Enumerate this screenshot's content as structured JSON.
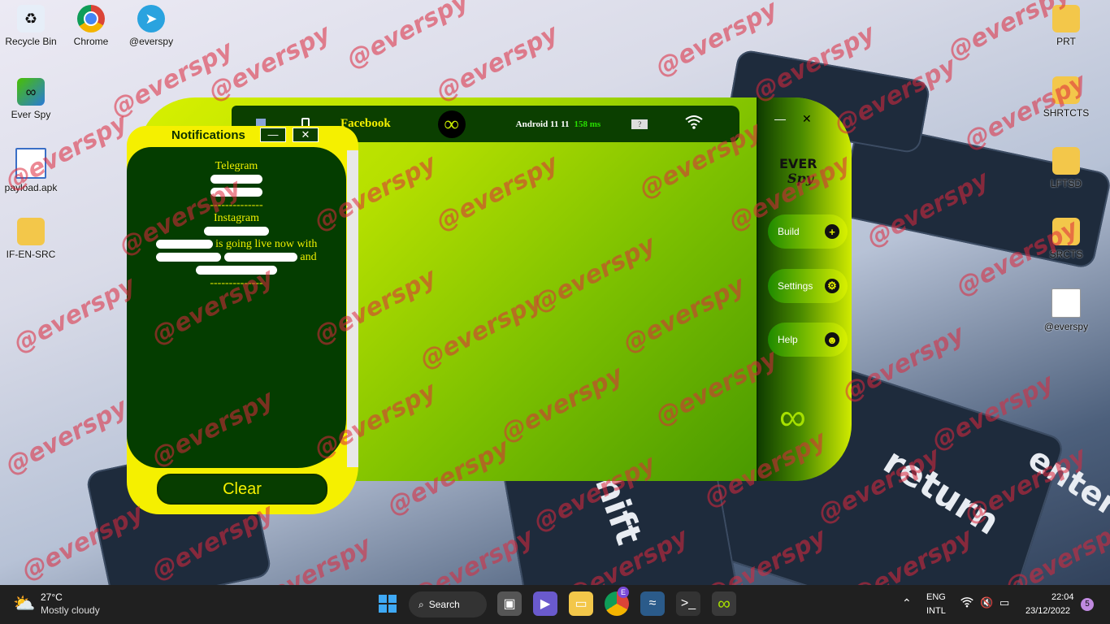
{
  "desktop": {
    "left_icons": [
      {
        "label": "Recycle Bin",
        "icon": "recycle-bin-icon"
      },
      {
        "label": "Chrome",
        "icon": "chrome-icon"
      },
      {
        "label": "@everspy",
        "icon": "telegram-icon"
      },
      {
        "label": "Ever Spy",
        "icon": "everspy-icon"
      },
      {
        "label": "payload.apk",
        "icon": "file-icon"
      },
      {
        "label": "IF-EN-SRC",
        "icon": "folder-icon"
      }
    ],
    "right_icons": [
      {
        "label": "PRT",
        "icon": "folder-icon"
      },
      {
        "label": "SHRTCTS",
        "icon": "folder-icon"
      },
      {
        "label": "LFTSD",
        "icon": "folder-icon"
      },
      {
        "label": "SRCTS",
        "icon": "folder-icon"
      },
      {
        "label": "@everspy",
        "icon": "document-icon"
      }
    ],
    "watermark": "@everspy",
    "keyboard_keys": [
      "shift",
      "return",
      "enter"
    ]
  },
  "app": {
    "topbar": {
      "app_label": "Facebook",
      "device": "Android 11 11",
      "ping": "158 ms",
      "help": "?"
    },
    "sidebar": {
      "logo_line1": "EVER",
      "logo_line2": "Spy",
      "buttons": [
        {
          "label": "Build",
          "icon": "plus-icon"
        },
        {
          "label": "Settings",
          "icon": "gear-icon"
        },
        {
          "label": "Help",
          "icon": "help-face-icon"
        }
      ],
      "window_min": "—",
      "window_close": "✕"
    }
  },
  "notifications": {
    "title": "Notifications",
    "min_label": "—",
    "close_label": "✕",
    "lines": [
      {
        "text": "Telegram"
      },
      {
        "text": "--------------"
      },
      {
        "text": "Instagram"
      },
      {
        "text": "is going live now with"
      },
      {
        "text": "and"
      },
      {
        "text": "--------------"
      }
    ],
    "clear_label": "Clear"
  },
  "taskbar": {
    "weather_temp": "27°C",
    "weather_desc": "Mostly cloudy",
    "search_label": "Search",
    "lang1": "ENG",
    "lang2": "INTL",
    "time": "22:04",
    "date": "23/12/2022",
    "notif_count": "5",
    "chrome_badge": "E"
  },
  "colors": {
    "accent_yellow": "#f5f000",
    "dark_green": "#043d00",
    "lime": "#b6e000",
    "ping_green": "#28e000"
  }
}
